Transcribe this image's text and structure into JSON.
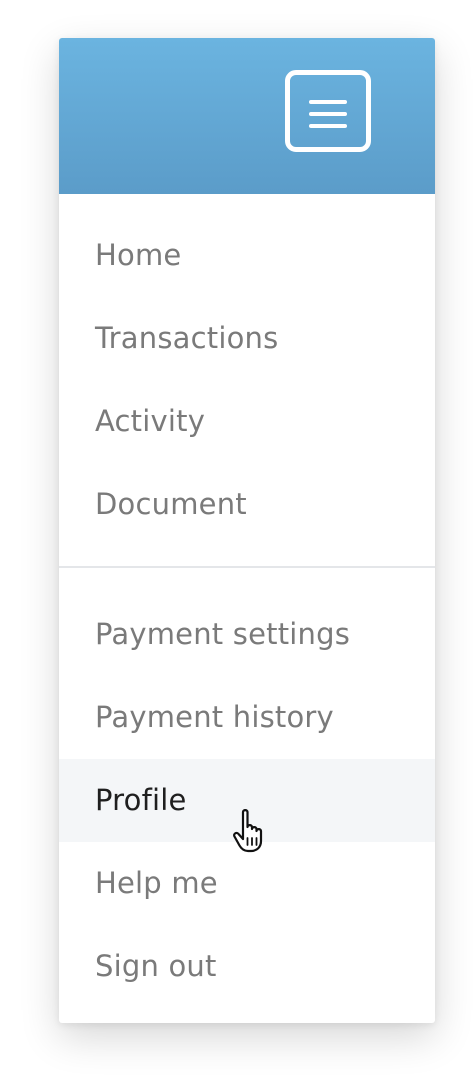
{
  "header": {
    "menu_icon": "hamburger-menu-icon",
    "background_color": "#62a8d6"
  },
  "menu": {
    "primary_items": [
      {
        "label": "Home"
      },
      {
        "label": "Transactions"
      },
      {
        "label": "Activity"
      },
      {
        "label": "Document"
      }
    ],
    "secondary_items": [
      {
        "label": "Payment settings"
      },
      {
        "label": "Payment history"
      },
      {
        "label": "Profile",
        "state": "hovered"
      },
      {
        "label": "Help me"
      },
      {
        "label": "Sign out"
      }
    ]
  },
  "pointer": {
    "icon": "hand-pointer-icon",
    "hovering_over": "Profile"
  }
}
